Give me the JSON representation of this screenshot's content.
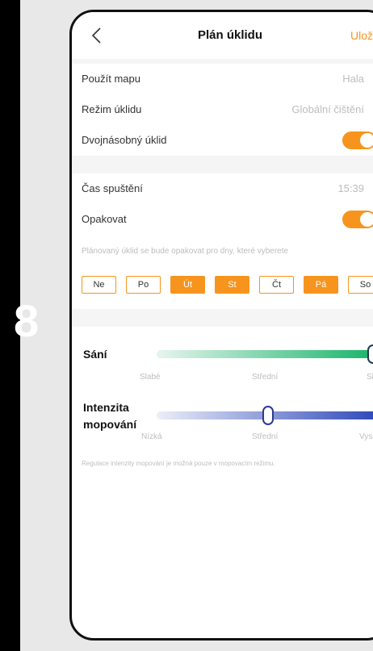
{
  "step_number": "8",
  "navbar": {
    "title": "Plán úklidu",
    "save_label": "Uložit"
  },
  "settings": {
    "map": {
      "label": "Použít mapu",
      "value": "Hala"
    },
    "mode": {
      "label": "Režim úklidu",
      "value": "Globální čištění"
    },
    "double_clean": {
      "label": "Dvojnásobný úklid",
      "enabled": true
    },
    "start_time": {
      "label": "Čas spuštění",
      "value": "15:39"
    },
    "repeat": {
      "label": "Opakovat",
      "enabled": true,
      "hint": "Plánovaný úklid se bude opakovat pro dny, které vyberete"
    },
    "days": [
      {
        "label": "Ne",
        "active": false
      },
      {
        "label": "Po",
        "active": false
      },
      {
        "label": "Út",
        "active": true
      },
      {
        "label": "St",
        "active": true
      },
      {
        "label": "Čt",
        "active": false
      },
      {
        "label": "Pá",
        "active": true
      },
      {
        "label": "So",
        "active": false
      }
    ]
  },
  "suction": {
    "label": "Sání",
    "ticks": [
      "Slabé",
      "Střední",
      "Silné"
    ],
    "level": 1.0
  },
  "mopping": {
    "label_line1": "Intenzita",
    "label_line2": "mopování",
    "ticks": [
      "Nízká",
      "Střední",
      "Vysoká"
    ],
    "level": 0.5,
    "note": "Regulace intenzity mopování je možná pouze v mopovacím režimu."
  },
  "colors": {
    "accent": "#f7941d",
    "suction_track": "#18b46a",
    "mop_track": "#2a44b8"
  }
}
